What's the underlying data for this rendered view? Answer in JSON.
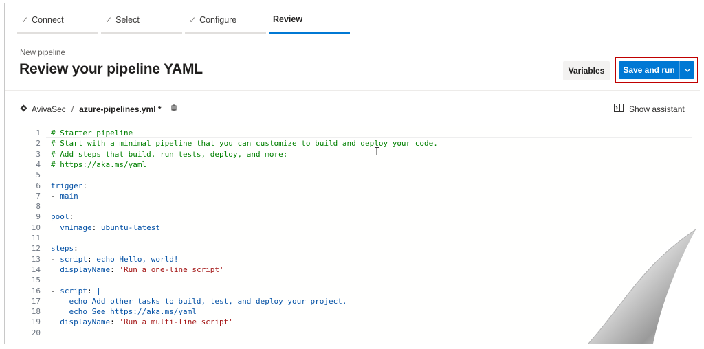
{
  "wizard": {
    "steps": [
      {
        "label": "Connect",
        "done": true
      },
      {
        "label": "Select",
        "done": true
      },
      {
        "label": "Configure",
        "done": true
      },
      {
        "label": "Review",
        "done": false,
        "active": true
      }
    ]
  },
  "header": {
    "subtitle": "New pipeline",
    "title": "Review your pipeline YAML"
  },
  "toolbar": {
    "variables_label": "Variables",
    "save_run_label": "Save and run"
  },
  "editor_header": {
    "repo": "AvivaSec",
    "separator": "/",
    "file": "azure-pipelines.yml *",
    "show_assistant_label": "Show assistant"
  },
  "code": {
    "lines": [
      {
        "n": "1",
        "t": "# Starter pipeline"
      },
      {
        "n": "2",
        "t": "# Start with a minimal pipeline that you can customize to build and deploy your code."
      },
      {
        "n": "3",
        "t": "# Add steps that build, run tests, deploy, and more:"
      },
      {
        "n": "4",
        "t": "# https://aka.ms/yaml"
      },
      {
        "n": "5",
        "t": ""
      },
      {
        "n": "6",
        "t": "trigger:"
      },
      {
        "n": "7",
        "t": "- main"
      },
      {
        "n": "8",
        "t": ""
      },
      {
        "n": "9",
        "t": "pool:"
      },
      {
        "n": "10",
        "t": "  vmImage: ubuntu-latest"
      },
      {
        "n": "11",
        "t": ""
      },
      {
        "n": "12",
        "t": "steps:"
      },
      {
        "n": "13",
        "t": "- script: echo Hello, world!"
      },
      {
        "n": "14",
        "t": "  displayName: 'Run a one-line script'"
      },
      {
        "n": "15",
        "t": ""
      },
      {
        "n": "16",
        "t": "- script: |"
      },
      {
        "n": "17",
        "t": "    echo Add other tasks to build, test, and deploy your project."
      },
      {
        "n": "18",
        "t": "    echo See https://aka.ms/yaml"
      },
      {
        "n": "19",
        "t": "  displayName: 'Run a multi-line script'"
      },
      {
        "n": "20",
        "t": ""
      }
    ]
  },
  "colors": {
    "accent": "#0078d4",
    "highlight_border": "#c00000",
    "comment": "#008000",
    "key": "#0451a5",
    "string": "#a31515"
  }
}
